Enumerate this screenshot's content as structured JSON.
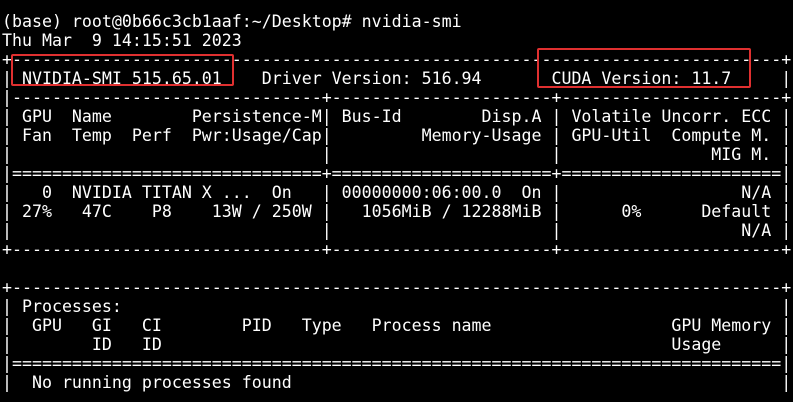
{
  "terminal": {
    "lines": [
      "                                                                              ",
      "(base) root@0b66c3cb1aaf:~/Desktop# nvidia-smi",
      "Thu Mar  9 14:15:51 2023",
      "+-----------------------------------------------------------------------------+",
      "| NVIDIA-SMI 515.65.01    Driver Version: 516.94       CUDA Version: 11.7     |",
      "|-------------------------------+----------------------+----------------------+",
      "| GPU  Name        Persistence-M| Bus-Id        Disp.A | Volatile Uncorr. ECC |",
      "| Fan  Temp  Perf  Pwr:Usage/Cap|         Memory-Usage | GPU-Util  Compute M. |",
      "|                               |                      |               MIG M. |",
      "|===============================+======================+======================|",
      "|   0  NVIDIA TITAN X ...  On   | 00000000:06:00.0  On |                  N/A |",
      "| 27%   47C    P8    13W / 250W |   1056MiB / 12288MiB |      0%      Default |",
      "|                               |                      |                  N/A |",
      "+-------------------------------+----------------------+----------------------+",
      "                                                                               ",
      "+-----------------------------------------------------------------------------+",
      "| Processes:                                                                  |",
      "|  GPU   GI   CI        PID   Type   Process name                  GPU Memory |",
      "|        ID   ID                                                   Usage      |",
      "|=============================================================================|",
      "|  No running processes found                                                 |"
    ]
  },
  "colors": {
    "background": "#000000",
    "text": "#ffffff",
    "highlight": "#e03030"
  }
}
